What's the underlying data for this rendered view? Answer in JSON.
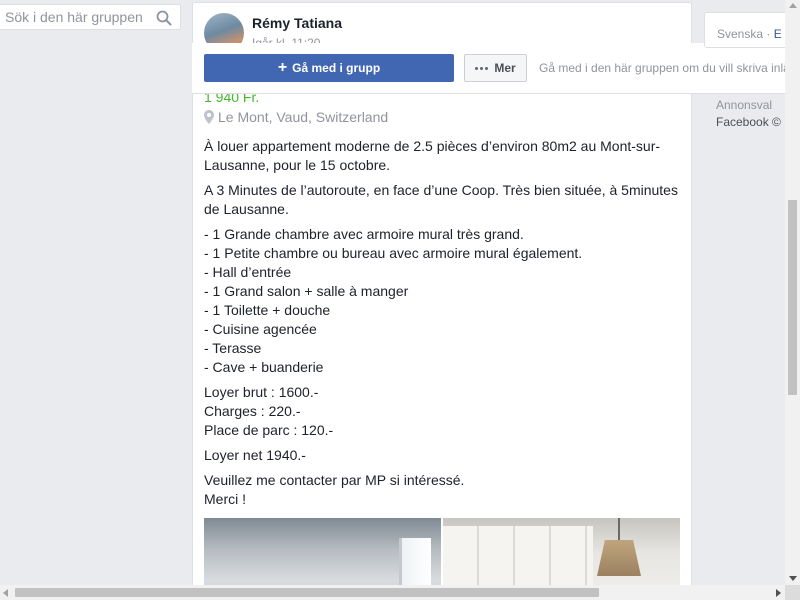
{
  "search": {
    "placeholder": "Sök i den här gruppen"
  },
  "post": {
    "author": "Rémy Tatiana",
    "timestamp": "Igår kl. 11:20",
    "price": "1 940 Fr.",
    "location": "Le Mont, Vaud, Switzerland",
    "paragraphs": [
      [
        "À louer appartement moderne de 2.5 pièces d’environ 80m2 au Mont-sur-Lausanne, pour le 15 octobre."
      ],
      [
        "A 3 Minutes de l’autoroute, en face d’une Coop. Très bien située, à 5minutes de Lausanne."
      ],
      [
        "- 1 Grande chambre avec armoire mural très grand.",
        "- 1 Petite chambre ou bureau avec armoire mural également.",
        "- Hall d’entrée",
        "- 1 Grand salon + salle à manger",
        "- 1 Toilette + douche",
        "- Cuisine agencée",
        "- Terasse",
        "- Cave + buanderie"
      ],
      [
        "Loyer brut : 1600.-",
        "Charges : 220.-",
        "Place de parc : 120.-"
      ],
      [
        "Loyer net 1940.-"
      ],
      [
        "Veuillez me contacter par MP si intéressé.",
        "Merci !"
      ]
    ]
  },
  "joinbar": {
    "join_label": "Gå med i grupp",
    "more_label": "Mer",
    "hint": "Gå med i den här gruppen om du vill skriva inlägg"
  },
  "right": {
    "lang_current": "Svenska",
    "lang_separator": " · ",
    "lang_other": "E",
    "ads": "Annonsval",
    "copyright": "Facebook ©"
  },
  "icons": {
    "search": "search-icon",
    "pin": "location-pin-icon",
    "plus": "plus-icon",
    "more": "more-dots-icon"
  },
  "colors": {
    "brand_blue": "#4267b2",
    "price_green": "#42b72a",
    "link_blue": "#385898",
    "background": "#e9ebee"
  }
}
